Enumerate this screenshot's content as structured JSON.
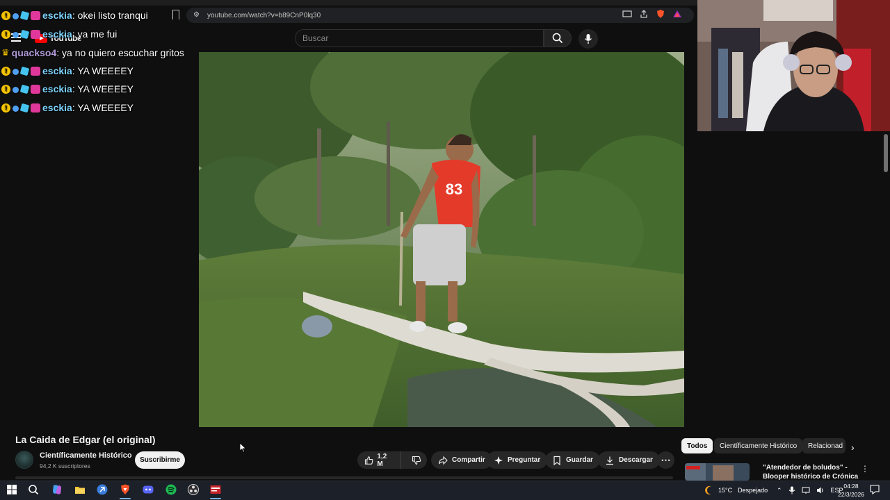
{
  "browser": {
    "url": "youtube.com/watch?v=b89CnP0lq30"
  },
  "youtube": {
    "logo_text": "YouTube",
    "search_placeholder": "Buscar"
  },
  "chat": {
    "messages": [
      {
        "user": "esckia",
        "text": ": okei listo tranqui",
        "user_color": "#7dd3fc"
      },
      {
        "user": "esckia",
        "text": ": ya me fui",
        "user_color": "#7dd3fc"
      },
      {
        "user": "quackso4",
        "text": ": ya no quiero escuchar gritos",
        "user_color": "#b39ddb"
      },
      {
        "user": "esckia",
        "text": ": YA WEEEEY",
        "user_color": "#7dd3fc"
      },
      {
        "user": "esckia",
        "text": ": YA WEEEEY",
        "user_color": "#7dd3fc"
      },
      {
        "user": "esckia",
        "text": ": YA WEEEEY",
        "user_color": "#7dd3fc"
      }
    ]
  },
  "video": {
    "title": "La Caida de Edgar (el original)",
    "jersey_number": "83",
    "channel_name": "Científicamente Histórico",
    "subscribers": "94,2 K suscriptores",
    "subscribe_label": "Suscribirme",
    "likes": "1,2 M",
    "share_label": "Compartir",
    "ask_label": "Preguntar",
    "save_label": "Guardar",
    "download_label": "Descargar",
    "more_label": "⋯"
  },
  "sidebar": {
    "chips": [
      "Todos",
      "Científicamente Histórico",
      "Relacionad"
    ],
    "active_chip": "Todos",
    "recommendation": {
      "title_line1": "\"Atendedor de boludos\" -",
      "title_line2": "Blooper histórico de Crónica HD"
    }
  },
  "taskbar": {
    "weather_temp": "15°C",
    "weather_desc": "Despejado",
    "language": "ESP",
    "time": "04:28",
    "date": "22/3/2026"
  },
  "colors": {
    "background": "#0f0f0f",
    "pill": "#272727",
    "youtube_red": "#ff0000",
    "taskbar": "#1c2029"
  }
}
